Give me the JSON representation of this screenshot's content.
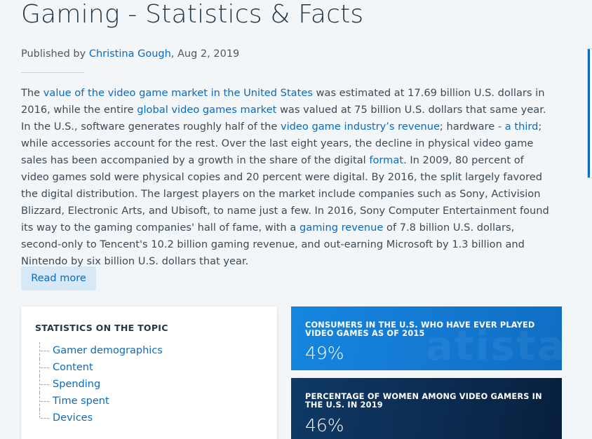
{
  "header": {
    "title": "Gaming - Statistics & Facts",
    "published_prefix": "Published by ",
    "author": "Christina Gough",
    "date": ", Aug 2, 2019"
  },
  "body": {
    "p1": "The ",
    "link1": "value of the video game market in the United States",
    "p2": " was estimated at 17.69 billion U.S. dollars in 2016, while the entire ",
    "link2": "global video games market",
    "p3": " was valued at 75 billion U.S. dollars that same year. In the U.S., software generates roughly half of the ",
    "link3": "video game industry’s revenue",
    "p4": "; hardware ",
    "link4": "- a third",
    "p5": "; while accessories account for the rest. Over the last eight years, the decline in physical video game sales has been accompanied by a growth in the share of the digital ",
    "link5": "format",
    "p6": ". In 2009, 80 percent of video games sold were physical copies and 20 percent were digital. By 2016, the split largely favored the digital distribution. The largest players on the market include companies such as Sony, Activision Blizzard, Electronic Arts, and Ubisoft, to name just a few. In 2016, Sony Computer Entertainment found its way to the gaming companies' hall of fame, with a ",
    "link6": "gaming revenue",
    "p7": " of 7.8 billion U.S. dollars, second-only to Tencent's 10.2 billion gaming revenue, and out-earning Microsoft by 1.3 billion and Nintendo by six billion U.S. dollars that year."
  },
  "read_more_label": "Read more",
  "topic_card": {
    "heading": "STATISTICS ON THE TOPIC",
    "items": [
      "Gamer demographics",
      "Content",
      "Spending",
      "Time spent",
      "Devices"
    ]
  },
  "stats": [
    {
      "label": "CONSUMERS IN THE U.S. WHO HAVE EVER PLAYED VIDEO GAMES AS OF 2015",
      "value": "49%"
    },
    {
      "label": "PERCENTAGE OF WOMEN AMONG VIDEO GAMERS IN THE U.S. IN 2019",
      "value": "46%"
    }
  ],
  "colors": {
    "link": "#0b6bbf",
    "stat_blue": "#1586df",
    "stat_navy": "#0b2a4f",
    "button_bg": "#d7e8f6"
  }
}
